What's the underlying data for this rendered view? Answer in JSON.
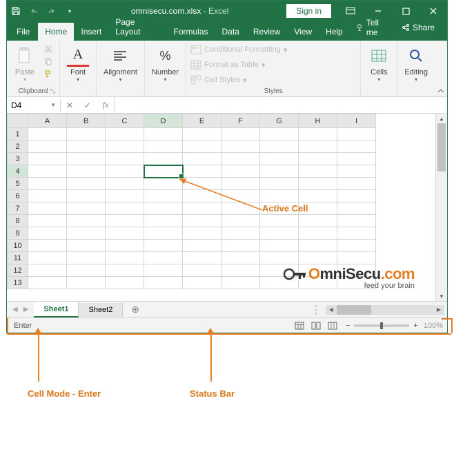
{
  "titlebar": {
    "filename": "omnisecu.com.xlsx",
    "appname": "Excel",
    "signin": "Sign in"
  },
  "tabs": {
    "file": "File",
    "items": [
      "Home",
      "Insert",
      "Page Layout",
      "Formulas",
      "Data",
      "Review",
      "View",
      "Help"
    ],
    "active_index": 0,
    "tellme": "Tell me",
    "share": "Share"
  },
  "ribbon": {
    "clipboard": {
      "label": "Clipboard",
      "paste": "Paste"
    },
    "font": {
      "label": "Font",
      "btn": "Font",
      "letter": "A"
    },
    "alignment": {
      "label": "Alignment"
    },
    "number": {
      "label": "Number",
      "pct": "%"
    },
    "styles": {
      "label": "Styles",
      "cond": "Conditional Formatting",
      "table": "Format as Table",
      "cell": "Cell Styles"
    },
    "cells": {
      "label": "Cells"
    },
    "editing": {
      "label": "Editing"
    }
  },
  "formula_bar": {
    "name_box": "D4",
    "fx": "fx",
    "value": ""
  },
  "grid": {
    "cols": [
      "A",
      "B",
      "C",
      "D",
      "E",
      "F",
      "G",
      "H",
      "I"
    ],
    "rows": [
      1,
      2,
      3,
      4,
      5,
      6,
      7,
      8,
      9,
      10,
      11,
      12,
      13
    ],
    "active_col": "D",
    "active_row": 4
  },
  "annotations": {
    "active_cell": "Active Cell",
    "cell_mode": "Cell Mode - Enter",
    "status_bar": "Status Bar"
  },
  "watermark": {
    "text1": "O",
    "text2": "mniSecu",
    "text3": ".com",
    "sub": "feed your brain"
  },
  "sheet_tabs": {
    "items": [
      "Sheet1",
      "Sheet2"
    ],
    "active_index": 0
  },
  "statusbar": {
    "mode": "Enter",
    "zoom": "100%"
  }
}
